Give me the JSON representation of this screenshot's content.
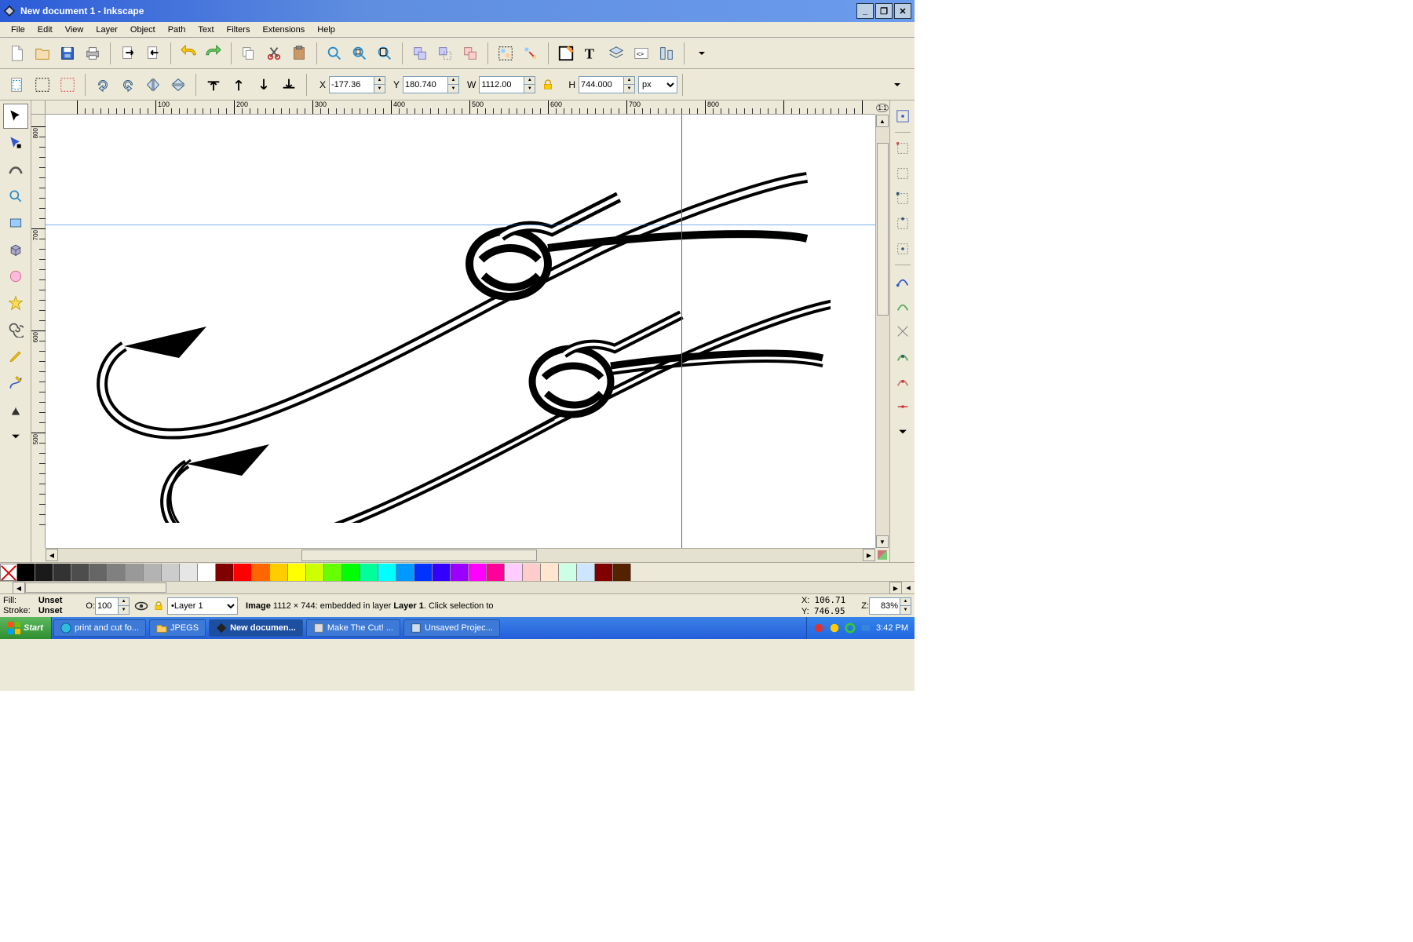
{
  "window": {
    "title": "New document 1 - Inkscape"
  },
  "menu": [
    "File",
    "Edit",
    "View",
    "Layer",
    "Object",
    "Path",
    "Text",
    "Filters",
    "Extensions",
    "Help"
  ],
  "coords": {
    "x": "-177.36",
    "y": "180.740",
    "w": "1112.00",
    "h": "744.000",
    "unit": "px",
    "x_label": "X",
    "y_label": "Y",
    "w_label": "W",
    "h_label": "H"
  },
  "ruler": {
    "hticks": [
      100,
      200,
      300,
      400,
      500,
      600,
      700,
      800
    ],
    "vticks": [
      800,
      700,
      600,
      500
    ]
  },
  "palette_colors": [
    "#000000",
    "#1a1a1a",
    "#333333",
    "#4d4d4d",
    "#666666",
    "#808080",
    "#999999",
    "#b3b3b3",
    "#cccccc",
    "#e6e6e6",
    "#ffffff",
    "#800000",
    "#ff0000",
    "#ff6600",
    "#ffcc00",
    "#ffff00",
    "#ccff00",
    "#66ff00",
    "#00ff00",
    "#00ff99",
    "#00ffff",
    "#0099ff",
    "#0033ff",
    "#3300ff",
    "#9900ff",
    "#ff00ff",
    "#ff0099",
    "#ffccff",
    "#ffcccc",
    "#ffe6cc",
    "#ccffe6",
    "#cce6ff",
    "#800000",
    "#552200"
  ],
  "status": {
    "fill_label": "Fill:",
    "fill_value": "Unset",
    "stroke_label": "Stroke:",
    "stroke_value": "Unset",
    "opacity_label": "O:",
    "opacity_value": "100",
    "layer_value": " •Layer 1",
    "message_prefix": "Image ",
    "message_dims": "1112 × 744",
    "message_mid": ": embedded in layer ",
    "message_layer": "Layer 1",
    "message_suffix": ". Click selection to",
    "cursor_xlabel": "X:",
    "cursor_x": "106.71",
    "cursor_ylabel": "Y:",
    "cursor_y": "746.95",
    "zoom_label": "Z:",
    "zoom_value": "83%"
  },
  "taskbar": {
    "start": "Start",
    "items": [
      "print and cut fo...",
      "JPEGS",
      "New documen...",
      "Make The Cut! ...",
      "Unsaved Projec..."
    ],
    "active_index": 2,
    "clock": "3:42 PM"
  }
}
